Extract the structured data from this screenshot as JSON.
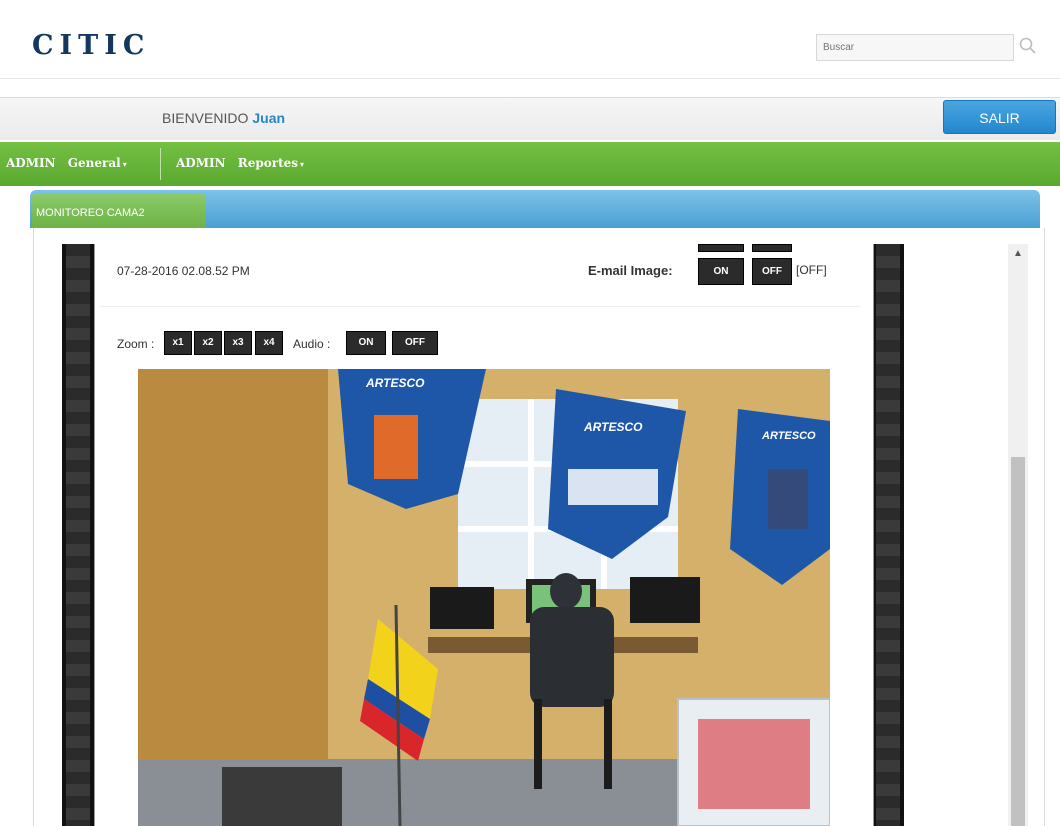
{
  "header": {
    "logo": "CITIC",
    "search_placeholder": "Buscar"
  },
  "welcome": {
    "greeting": "BIENVENIDO",
    "user": "Juan",
    "logout_label": "SALIR"
  },
  "nav": {
    "items": [
      {
        "role": "ADMIN",
        "label": "General"
      },
      {
        "role": "ADMIN",
        "label": "Reportes"
      }
    ]
  },
  "tab": {
    "active_label": "MONITOREO CAMA2"
  },
  "camera": {
    "timestamp": "07-28-2016 02.08.52 PM",
    "email_label": "E-mail Image:",
    "email_on": "ON",
    "email_off": "OFF",
    "email_state": "[OFF]",
    "zoom_label": "Zoom :",
    "zoom_buttons": [
      "x1",
      "x2",
      "x3",
      "x4"
    ],
    "audio_label": "Audio :",
    "audio_on": "ON",
    "audio_off": "OFF",
    "banner_text": "ARTESCO"
  },
  "colors": {
    "nav_green": "#65b436",
    "tab_blue": "#4a9fd3",
    "logout_blue": "#2387cf",
    "logo_navy": "#14375e"
  }
}
